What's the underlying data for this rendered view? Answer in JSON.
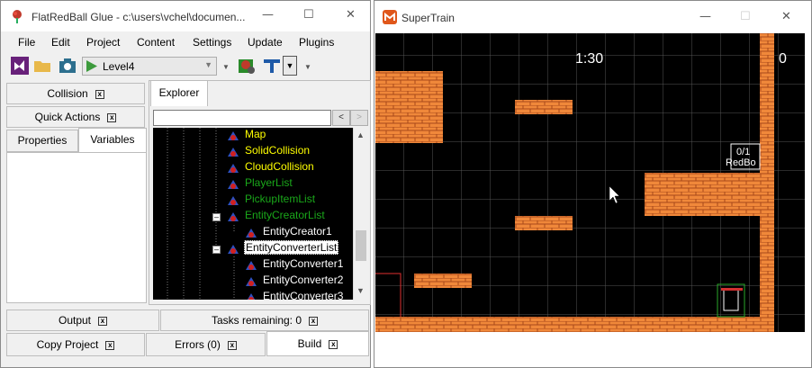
{
  "glue": {
    "title": "FlatRedBall Glue - c:\\users\\vchel\\documen...",
    "menu": [
      "File",
      "Edit",
      "Project",
      "Content",
      "Settings",
      "Update",
      "Plugins"
    ],
    "toolbar": {
      "level": "Level4"
    },
    "tabs_top": {
      "collision": "Collision",
      "quick_actions": "Quick Actions",
      "properties": "Properties",
      "variables": "Variables",
      "explorer": "Explorer"
    },
    "nav": {
      "back": "<",
      "forward": ">"
    },
    "tree": [
      {
        "label": "Map",
        "color": "#ffff00"
      },
      {
        "label": "SolidCollision",
        "color": "#ffff00"
      },
      {
        "label": "CloudCollision",
        "color": "#ffff00"
      },
      {
        "label": "PlayerList",
        "color": "#1aa81a"
      },
      {
        "label": "PickupItemList",
        "color": "#1aa81a"
      },
      {
        "label": "EntityCreatorList",
        "color": "#1aa81a"
      },
      {
        "label": "EntityCreator1",
        "color": "#ffffff"
      },
      {
        "label": "EntityConverterList",
        "color": "#000000"
      },
      {
        "label": "EntityConverter1",
        "color": "#ffffff"
      },
      {
        "label": "EntityConverter2",
        "color": "#ffffff"
      },
      {
        "label": "EntityConverter3",
        "color": "#ffffff"
      }
    ],
    "tabs_bottom": {
      "output": "Output",
      "tasks": "Tasks remaining: 0",
      "copy_project": "Copy Project",
      "errors": "Errors (0)",
      "build": "Build"
    }
  },
  "game": {
    "title": "SuperTrain",
    "timer": "1:30",
    "score": "0",
    "label_count": "0/1",
    "label_name": "RedBo",
    "brick_color": "#f0883a",
    "grid_color": "#5a5a5a"
  }
}
